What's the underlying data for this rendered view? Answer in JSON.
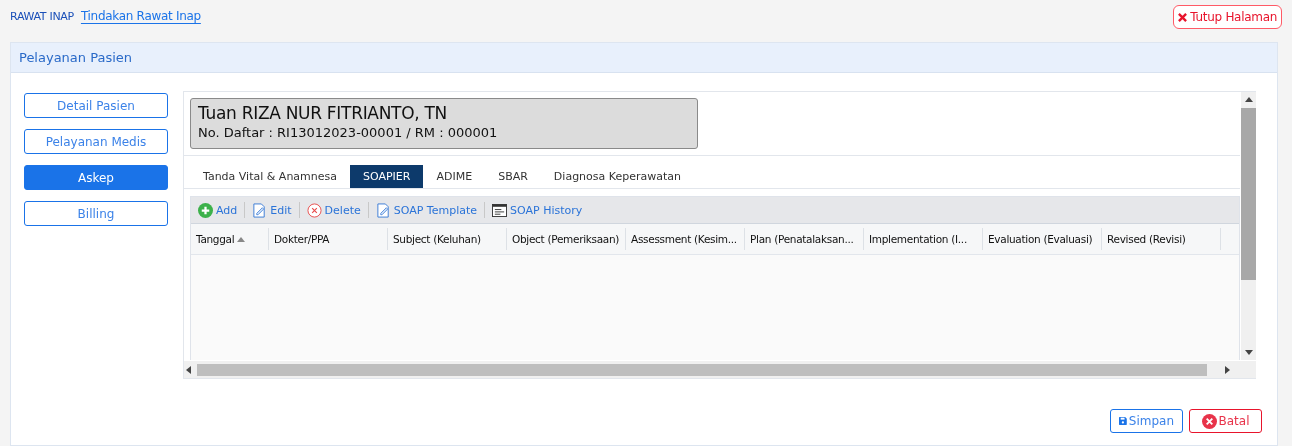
{
  "breadcrumb": [
    {
      "label": "RAWAT INAP",
      "selected": false
    },
    {
      "label": "Tindakan Rawat Inap",
      "selected": true
    }
  ],
  "close_button": "Tutup Halaman",
  "panel": {
    "title": "Pelayanan Pasien"
  },
  "sidebar": {
    "items": [
      {
        "label": "Detail Pasien",
        "selected": false
      },
      {
        "label": "Pelayanan Medis",
        "selected": false
      },
      {
        "label": "Askep",
        "selected": true
      },
      {
        "label": "Billing",
        "selected": false
      }
    ]
  },
  "patient": {
    "name": "Tuan RIZA NUR FITRIANTO, TN",
    "registration": "No. Daftar : RI13012023-00001 / RM : 000001"
  },
  "tabs": [
    {
      "label": "Tanda Vital & Anamnesa",
      "selected": false
    },
    {
      "label": "SOAPIER",
      "selected": true
    },
    {
      "label": "ADIME",
      "selected": false
    },
    {
      "label": "SBAR",
      "selected": false
    },
    {
      "label": "Diagnosa Keperawatan",
      "selected": false
    }
  ],
  "toolbar": [
    {
      "kind": "add",
      "label": "Add"
    },
    {
      "kind": "edit",
      "label": "Edit"
    },
    {
      "kind": "delete",
      "label": "Delete"
    },
    {
      "kind": "template",
      "label": "SOAP Template"
    },
    {
      "kind": "history",
      "label": "SOAP History"
    }
  ],
  "table": {
    "columns": [
      {
        "label": "Tanggal",
        "sorted": true
      },
      {
        "label": "Dokter/PPA",
        "sorted": false
      },
      {
        "label": "Subject (Keluhan)",
        "sorted": false
      },
      {
        "label": "Object (Pemeriksaan)",
        "sorted": false
      },
      {
        "label": "Assessment (Kesim...",
        "sorted": false
      },
      {
        "label": "Plan (Penatalaksan...",
        "sorted": false
      },
      {
        "label": "Implementation (I...",
        "sorted": false
      },
      {
        "label": "Evaluation (Evaluasi)",
        "sorted": false
      },
      {
        "label": "Revised (Revisi)",
        "sorted": false
      }
    ]
  },
  "footer": [
    {
      "kind": "save",
      "label": "Simpan"
    },
    {
      "kind": "cancel",
      "label": "Batal"
    }
  ]
}
